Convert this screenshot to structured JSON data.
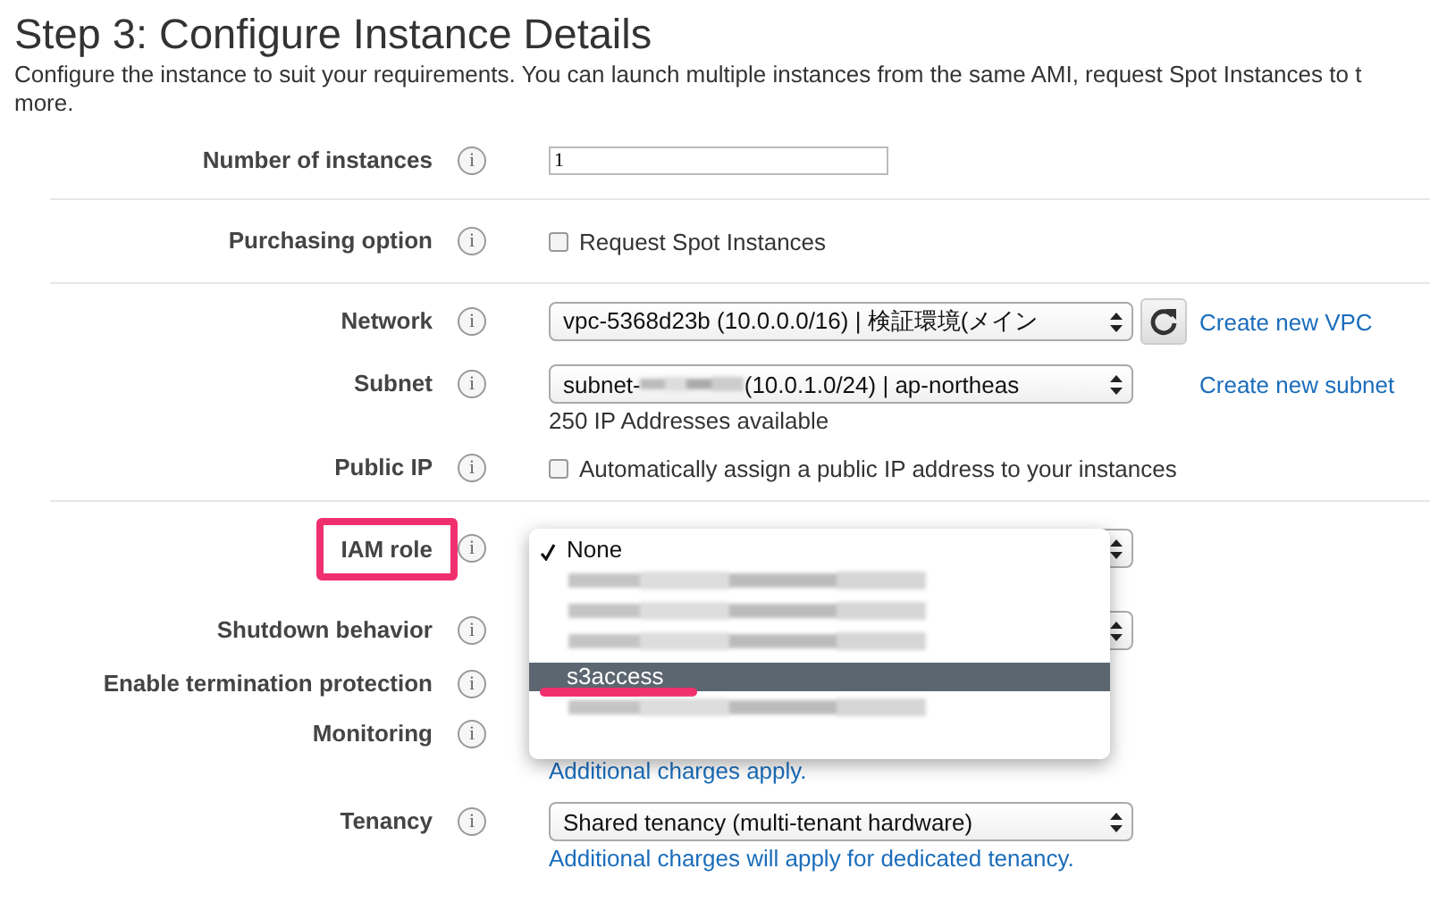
{
  "title": "Step 3: Configure Instance Details",
  "description": [
    "Configure the instance to suit your requirements. You can launch multiple instances from the same AMI, request Spot Instances to t",
    "more."
  ],
  "sections": [
    {
      "rows": [
        {
          "label": "Number of instances",
          "info": "i",
          "kind": "input",
          "value": "1"
        }
      ]
    },
    {
      "rows": [
        {
          "label": "Purchasing option",
          "info": "i",
          "kind": "checkbox",
          "text": "Request Spot Instances",
          "checked": false
        }
      ]
    },
    {
      "rows": [
        {
          "label": "Network",
          "info": "i",
          "kind": "select",
          "value": "vpc-5368d23b (10.0.0.0/16) | 検証環境(メイン",
          "refresh": true,
          "link": "Create new VPC"
        },
        {
          "label": "Subnet",
          "info": "i",
          "kind": "select",
          "value": "subnet-",
          "value_after": "(10.0.1.0/24) | ap-northeas",
          "redacted": true,
          "link": "Create new subnet",
          "note": "250 IP Addresses available"
        },
        {
          "label": "Public IP",
          "info": "i",
          "kind": "checkbox",
          "text": "Automatically assign a public IP address to your instances",
          "checked": false
        }
      ]
    },
    {
      "rows": [
        {
          "label": "IAM role",
          "info": "i",
          "kind": "select",
          "highlighted": true
        },
        {
          "label": "Shutdown behavior",
          "info": "i",
          "kind": "select"
        },
        {
          "label": "Enable termination protection",
          "info": "i",
          "kind": "hidden"
        },
        {
          "label": "Monitoring",
          "info": "i",
          "kind": "hidden",
          "link_note": "Additional charges apply."
        },
        {
          "label": "Tenancy",
          "info": "i",
          "kind": "select",
          "value": "Shared tenancy (multi-tenant hardware)",
          "link_note": "Additional charges will apply for dedicated tenancy."
        }
      ]
    }
  ],
  "dropdown": {
    "options": [
      {
        "kind": "text",
        "label": "None",
        "checked": true,
        "highlighted": false,
        "underlined": false
      },
      {
        "kind": "redacted"
      },
      {
        "kind": "redacted"
      },
      {
        "kind": "redacted"
      },
      {
        "kind": "text",
        "label": "s3access",
        "checked": false,
        "highlighted": true,
        "underlined": true
      },
      {
        "kind": "redacted"
      }
    ]
  }
}
